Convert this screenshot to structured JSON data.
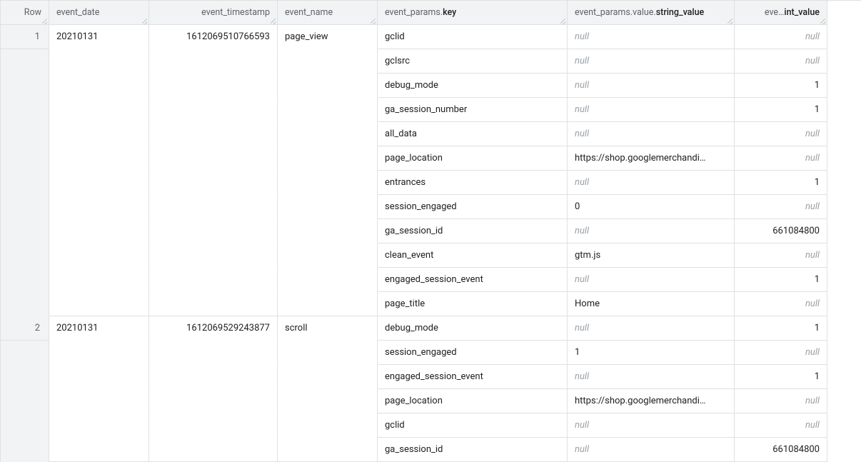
{
  "columns": [
    {
      "label": "Row",
      "bold": "",
      "align": "num"
    },
    {
      "label": "event_date",
      "bold": "",
      "align": "left"
    },
    {
      "label": "event_timestamp",
      "bold": "",
      "align": "num"
    },
    {
      "label": "event_name",
      "bold": "",
      "align": "left"
    },
    {
      "label": "event_params.",
      "bold": "key",
      "align": "left"
    },
    {
      "label": "event_params.value.",
      "bold": "string_value",
      "align": "left"
    },
    {
      "label": "eve…",
      "bold": "int_value",
      "align": "num"
    }
  ],
  "rows": [
    {
      "row": "1",
      "event_date": "20210131",
      "event_timestamp": "1612069510766593",
      "event_name": "page_view",
      "params": [
        {
          "key": "gclid",
          "string_value": null,
          "int_value": null
        },
        {
          "key": "gclsrc",
          "string_value": null,
          "int_value": null
        },
        {
          "key": "debug_mode",
          "string_value": null,
          "int_value": "1"
        },
        {
          "key": "ga_session_number",
          "string_value": null,
          "int_value": "1"
        },
        {
          "key": "all_data",
          "string_value": null,
          "int_value": null
        },
        {
          "key": "page_location",
          "string_value": "https://shop.googlemerchandi…",
          "int_value": null
        },
        {
          "key": "entrances",
          "string_value": null,
          "int_value": "1"
        },
        {
          "key": "session_engaged",
          "string_value": "0",
          "int_value": null
        },
        {
          "key": "ga_session_id",
          "string_value": null,
          "int_value": "661084800"
        },
        {
          "key": "clean_event",
          "string_value": "gtm.js",
          "int_value": null
        },
        {
          "key": "engaged_session_event",
          "string_value": null,
          "int_value": "1"
        },
        {
          "key": "page_title",
          "string_value": "Home",
          "int_value": null
        }
      ]
    },
    {
      "row": "2",
      "event_date": "20210131",
      "event_timestamp": "1612069529243877",
      "event_name": "scroll",
      "params": [
        {
          "key": "debug_mode",
          "string_value": null,
          "int_value": "1"
        },
        {
          "key": "session_engaged",
          "string_value": "1",
          "int_value": null
        },
        {
          "key": "engaged_session_event",
          "string_value": null,
          "int_value": "1"
        },
        {
          "key": "page_location",
          "string_value": "https://shop.googlemerchandi…",
          "int_value": null
        },
        {
          "key": "gclid",
          "string_value": null,
          "int_value": null
        },
        {
          "key": "ga_session_id",
          "string_value": null,
          "int_value": "661084800"
        }
      ]
    }
  ]
}
